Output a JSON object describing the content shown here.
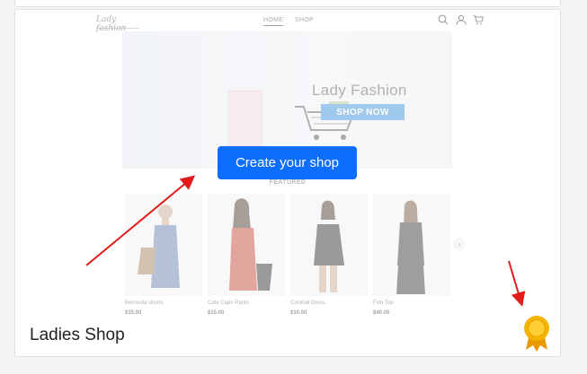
{
  "site": {
    "logo_text": "Lady fashion",
    "nav": [
      "HOME",
      "SHOP"
    ],
    "hero": {
      "title": "Lady Fashion",
      "cta": "SHOP NOW"
    },
    "section_label": "FEATURED",
    "products": [
      {
        "name": "Bermuda shorts",
        "price": "$15.00",
        "color": "#5b78a8"
      },
      {
        "name": "Cate Capri Pants",
        "price": "$15.00",
        "color": "#c0392b"
      },
      {
        "name": "Cocktail Dress",
        "price": "$10.00",
        "color": "#222222"
      },
      {
        "name": "Fish Top",
        "price": "$40.00",
        "color": "#2b2b2b"
      }
    ],
    "next_icon": "chevron-right-icon"
  },
  "overlay": {
    "button_label": "Create your shop"
  },
  "card": {
    "title": "Ladies Shop",
    "badge_icon": "award-ribbon-icon"
  },
  "colors": {
    "accent": "#0d6efd",
    "annotation_arrow": "#e31b1b",
    "badge": "#f5b400"
  }
}
